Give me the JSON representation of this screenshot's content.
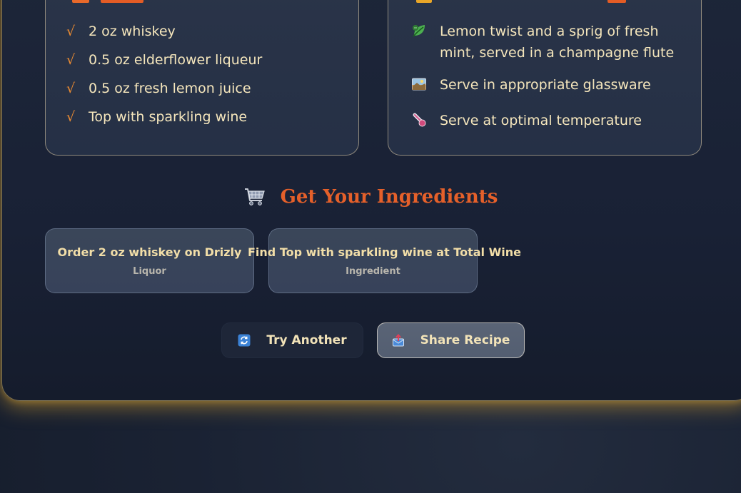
{
  "ingredients": {
    "check_symbol": "√",
    "items": [
      "2 oz whiskey",
      "0.5 oz elderflower liqueur",
      "0.5 oz fresh lemon juice",
      "Top with sparkling wine"
    ]
  },
  "garnish": {
    "items": [
      {
        "icon": "herb-icon",
        "text": "Lemon twist and a sprig of fresh mint, served in a champagne flute"
      },
      {
        "icon": "glassware-icon",
        "text": "Serve in appropriate glassware"
      },
      {
        "icon": "thermometer-icon",
        "text": "Serve at optimal temperature"
      }
    ]
  },
  "shopping": {
    "heading": "Get Your Ingredients",
    "heading_icon": "shopping-cart-icon",
    "cards": [
      {
        "title": "Order 2 oz whiskey on Drizly",
        "subtitle": "Liquor"
      },
      {
        "title": "Find Top with sparkling wine at Total Wine",
        "subtitle": "Ingredient"
      }
    ]
  },
  "actions": {
    "try_another": {
      "label": "Try Another",
      "icon": "refresh-icon"
    },
    "share": {
      "label": "Share Recipe",
      "icon": "share-icon"
    }
  },
  "colors": {
    "accent_orange": "#e5602a",
    "cream_text": "#f5e6bc",
    "glow": "#d6a032"
  }
}
